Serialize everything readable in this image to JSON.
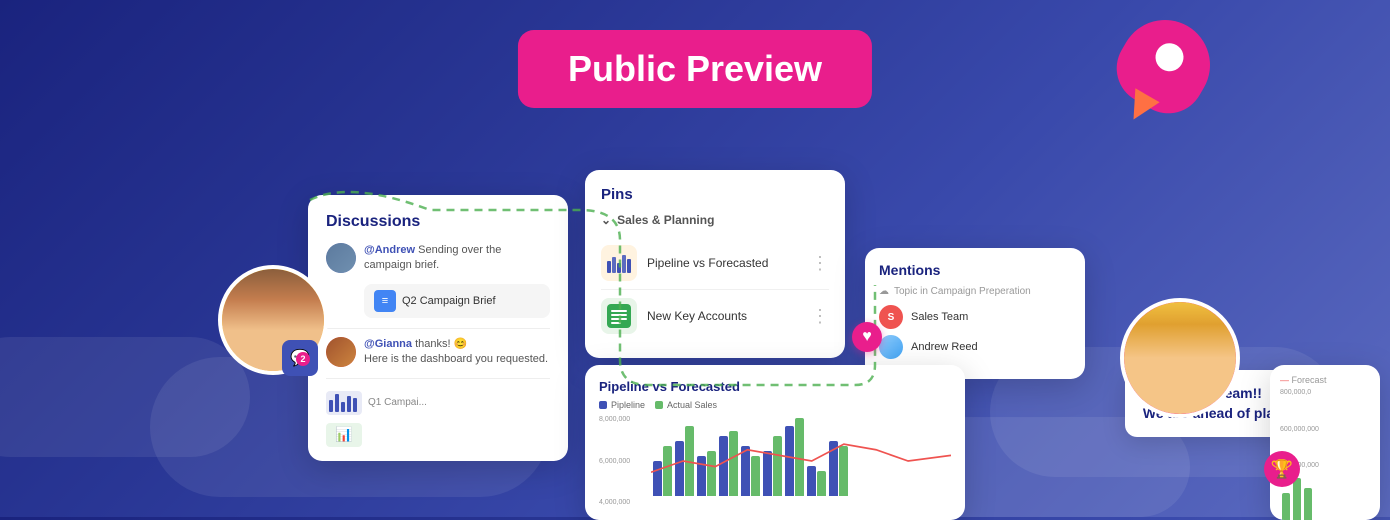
{
  "page": {
    "background": "#2d3a8c"
  },
  "header": {
    "badge_label": "Public Preview"
  },
  "discussions": {
    "title": "Discussions",
    "items": [
      {
        "author": "@Andrew",
        "text": "Sending over the campaign brief.",
        "attachment": "Q2 Campaign Brief"
      },
      {
        "author": "@Gianna",
        "text": "thanks! 😊 Here is the dashboard you requested."
      }
    ],
    "mini_items": [
      {
        "label": "Q1 Campai..."
      }
    ]
  },
  "pins": {
    "title": "Pins",
    "section": "Sales & Planning",
    "items": [
      {
        "name": "Pipeline vs Forecasted",
        "type": "chart"
      },
      {
        "name": "New Key Accounts",
        "type": "sheet"
      }
    ]
  },
  "mentions": {
    "title": "Mentions",
    "topic": "Topic in Campaign Preperation",
    "items": [
      {
        "name": "Sales Team",
        "type": "group"
      },
      {
        "name": "Andrew Reed",
        "type": "person"
      }
    ]
  },
  "pipeline": {
    "title": "Pipeline vs Forecasted",
    "legend": [
      {
        "label": "Pipleline",
        "color": "#3f51b5"
      },
      {
        "label": "Actual Sales",
        "color": "#66bb6a"
      },
      {
        "label": "Forecast",
        "color": "#ef5350"
      }
    ],
    "y_labels": [
      "8,000,000",
      "6,000,000",
      "4,000,000"
    ],
    "y_labels_right": [
      "800,000,0",
      "600,000,000",
      "400,000,000"
    ]
  },
  "comment": {
    "line1": "Great work team!!",
    "line2": "We are ahead of plan!!"
  },
  "notification": {
    "count": "2"
  },
  "icons": {
    "chevron": "›",
    "heart": "♥",
    "trophy": "🏆",
    "menu_dots": "⋮",
    "cloud": "☁",
    "chat": "💬"
  }
}
